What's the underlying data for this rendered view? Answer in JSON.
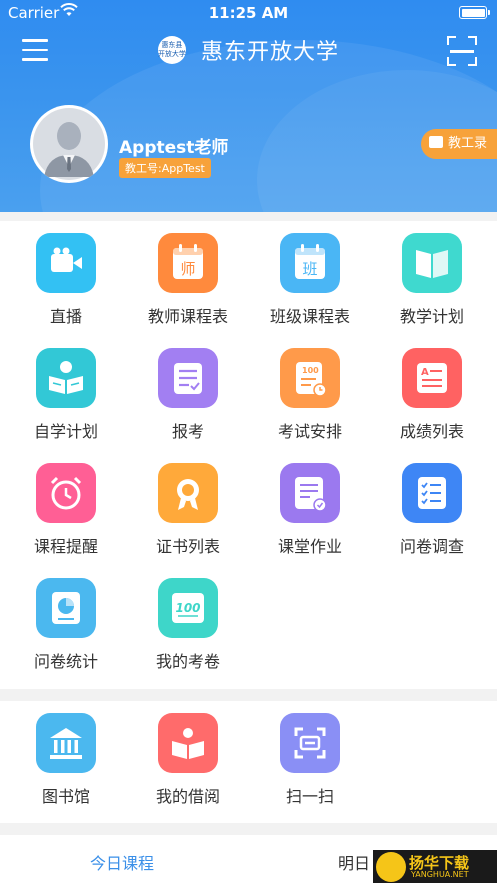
{
  "status_bar": {
    "carrier": "Carrier",
    "time": "11:25 AM"
  },
  "header": {
    "title": "惠东开放大学",
    "logo_text_line1": "惠东县",
    "logo_text_line2": "开放大学"
  },
  "profile": {
    "name": "Apptest老师",
    "staff_id": "教工号:AppTest",
    "records_button": "教工录"
  },
  "grid": [
    {
      "label": "直播",
      "icon": "video-camera-icon",
      "color": "#33c1f3"
    },
    {
      "label": "教师课程表",
      "icon": "calendar-teacher-icon",
      "color": "#ff8a3d"
    },
    {
      "label": "班级课程表",
      "icon": "calendar-class-icon",
      "color": "#4ab6f5"
    },
    {
      "label": "教学计划",
      "icon": "book-icon",
      "color": "#3fd9cf"
    },
    {
      "label": "自学计划",
      "icon": "self-study-icon",
      "color": "#32c8d6"
    },
    {
      "label": "报考",
      "icon": "form-icon",
      "color": "#a27ff2"
    },
    {
      "label": "考试安排",
      "icon": "exam-icon",
      "color": "#ff9a4a"
    },
    {
      "label": "成绩列表",
      "icon": "grade-list-icon",
      "color": "#ff6262"
    },
    {
      "label": "课程提醒",
      "icon": "alarm-clock-icon",
      "color": "#ff5f95"
    },
    {
      "label": "证书列表",
      "icon": "certificate-icon",
      "color": "#ffa93a"
    },
    {
      "label": "课堂作业",
      "icon": "homework-icon",
      "color": "#9b79ef"
    },
    {
      "label": "问卷调查",
      "icon": "checklist-icon",
      "color": "#3e86f5"
    },
    {
      "label": "问卷统计",
      "icon": "pie-stats-icon",
      "color": "#4bb8ef"
    },
    {
      "label": "我的考卷",
      "icon": "exam-paper-icon",
      "color": "#3ed6c9"
    }
  ],
  "grid2": [
    {
      "label": "图书馆",
      "icon": "library-icon",
      "color": "#4bb8ef"
    },
    {
      "label": "我的借阅",
      "icon": "open-book-icon",
      "color": "#ff6b6b"
    },
    {
      "label": "扫一扫",
      "icon": "scan-icon",
      "color": "#8a8ff5"
    }
  ],
  "tabs": {
    "today": "今日课程",
    "tomorrow": "明日"
  },
  "watermark": {
    "title": "扬华下载",
    "sub": "YANGHUA.NET"
  }
}
